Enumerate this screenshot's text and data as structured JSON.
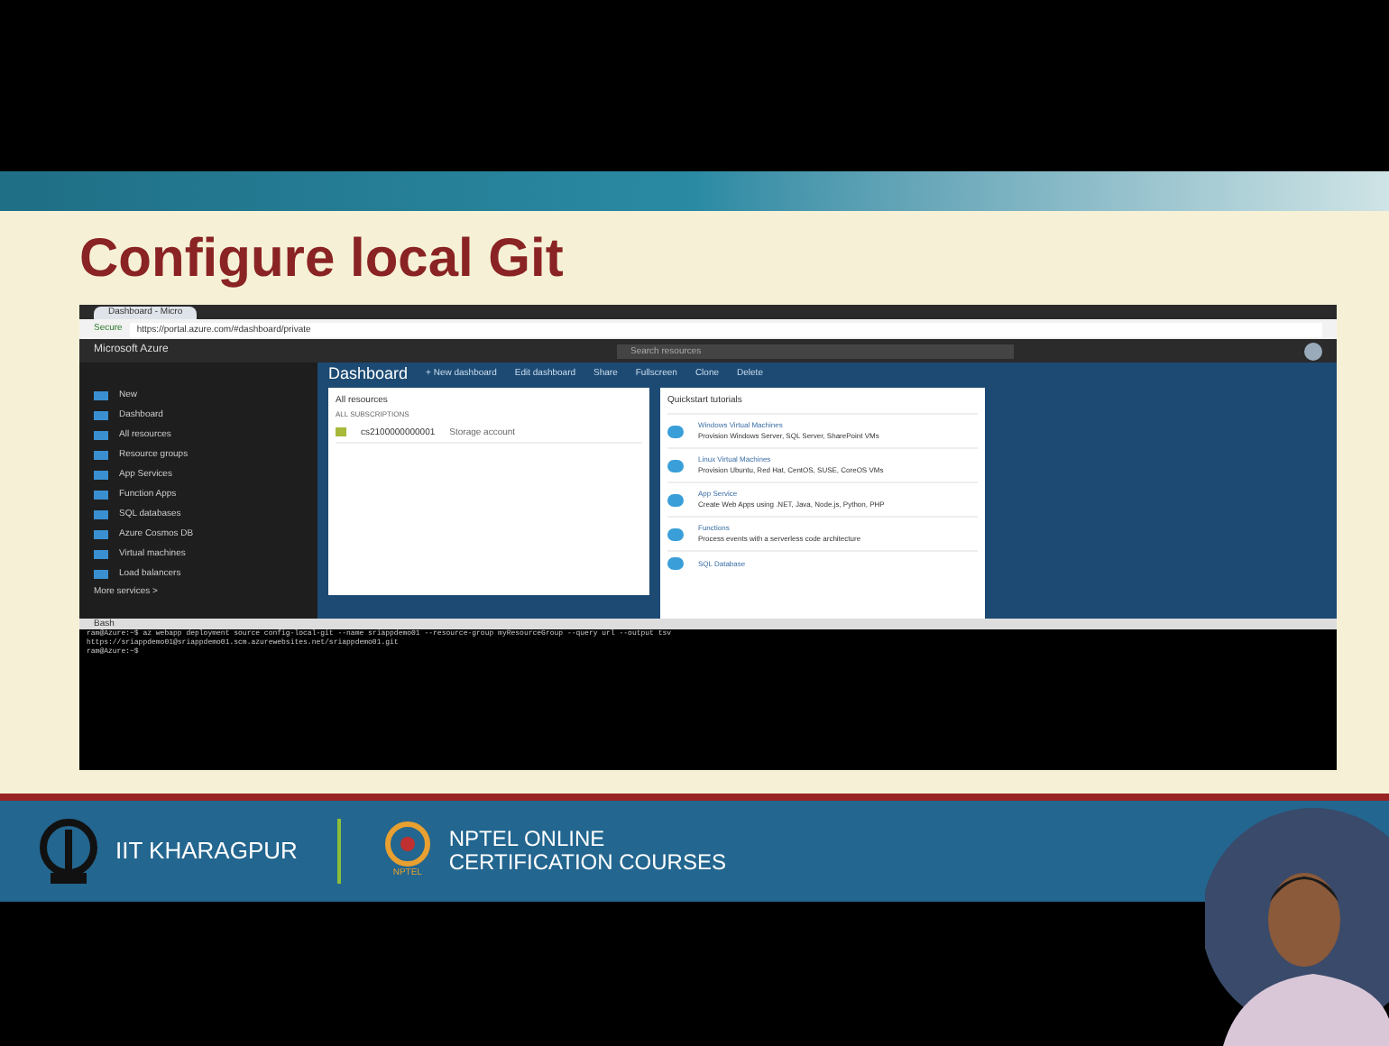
{
  "slide": {
    "title": "Configure local Git"
  },
  "browser": {
    "tab": "Dashboard - Micro",
    "address": "https://portal.azure.com/#dashboard/private",
    "secure_label": "Secure"
  },
  "portal": {
    "brand": "Microsoft Azure",
    "search_placeholder": "Search resources",
    "sidebar": [
      {
        "label": "New"
      },
      {
        "label": "Dashboard"
      },
      {
        "label": "All resources"
      },
      {
        "label": "Resource groups"
      },
      {
        "label": "App Services"
      },
      {
        "label": "Function Apps"
      },
      {
        "label": "SQL databases"
      },
      {
        "label": "Azure Cosmos DB"
      },
      {
        "label": "Virtual machines"
      },
      {
        "label": "Load balancers"
      }
    ],
    "more_services": "More services >",
    "dashboard_title": "Dashboard",
    "toolbar": [
      "+ New dashboard",
      "Edit dashboard",
      "Share",
      "Fullscreen",
      "Clone",
      "Delete"
    ],
    "resources_tile": {
      "title": "All resources",
      "subtitle": "ALL SUBSCRIPTIONS",
      "rows": [
        {
          "name": "cs2100000000001",
          "type": "Storage account"
        }
      ]
    },
    "quickstart": {
      "title": "Quickstart tutorials",
      "items": [
        {
          "title": "Windows Virtual Machines",
          "desc": "Provision Windows Server, SQL Server, SharePoint VMs"
        },
        {
          "title": "Linux Virtual Machines",
          "desc": "Provision Ubuntu, Red Hat, CentOS, SUSE, CoreOS VMs"
        },
        {
          "title": "App Service",
          "desc": "Create Web Apps using .NET, Java, Node.js, Python, PHP"
        },
        {
          "title": "Functions",
          "desc": "Process events with a serverless code architecture"
        },
        {
          "title": "SQL Database"
        }
      ]
    }
  },
  "shell": {
    "label": "Bash",
    "lines": [
      "ram@Azure:~$ az webapp deployment source config-local-git --name sriappdemo01 --resource-group myResourceGroup --query url --output tsv",
      "https://sriappdemo01@sriappdemo01.scm.azurewebsites.net/sriappdemo01.git",
      "ram@Azure:~$"
    ]
  },
  "footer": {
    "institute": "IIT KHARAGPUR",
    "course_line1": "NPTEL ONLINE",
    "course_line2": "CERTIFICATION COURSES",
    "logo_caption": "NPTEL"
  }
}
